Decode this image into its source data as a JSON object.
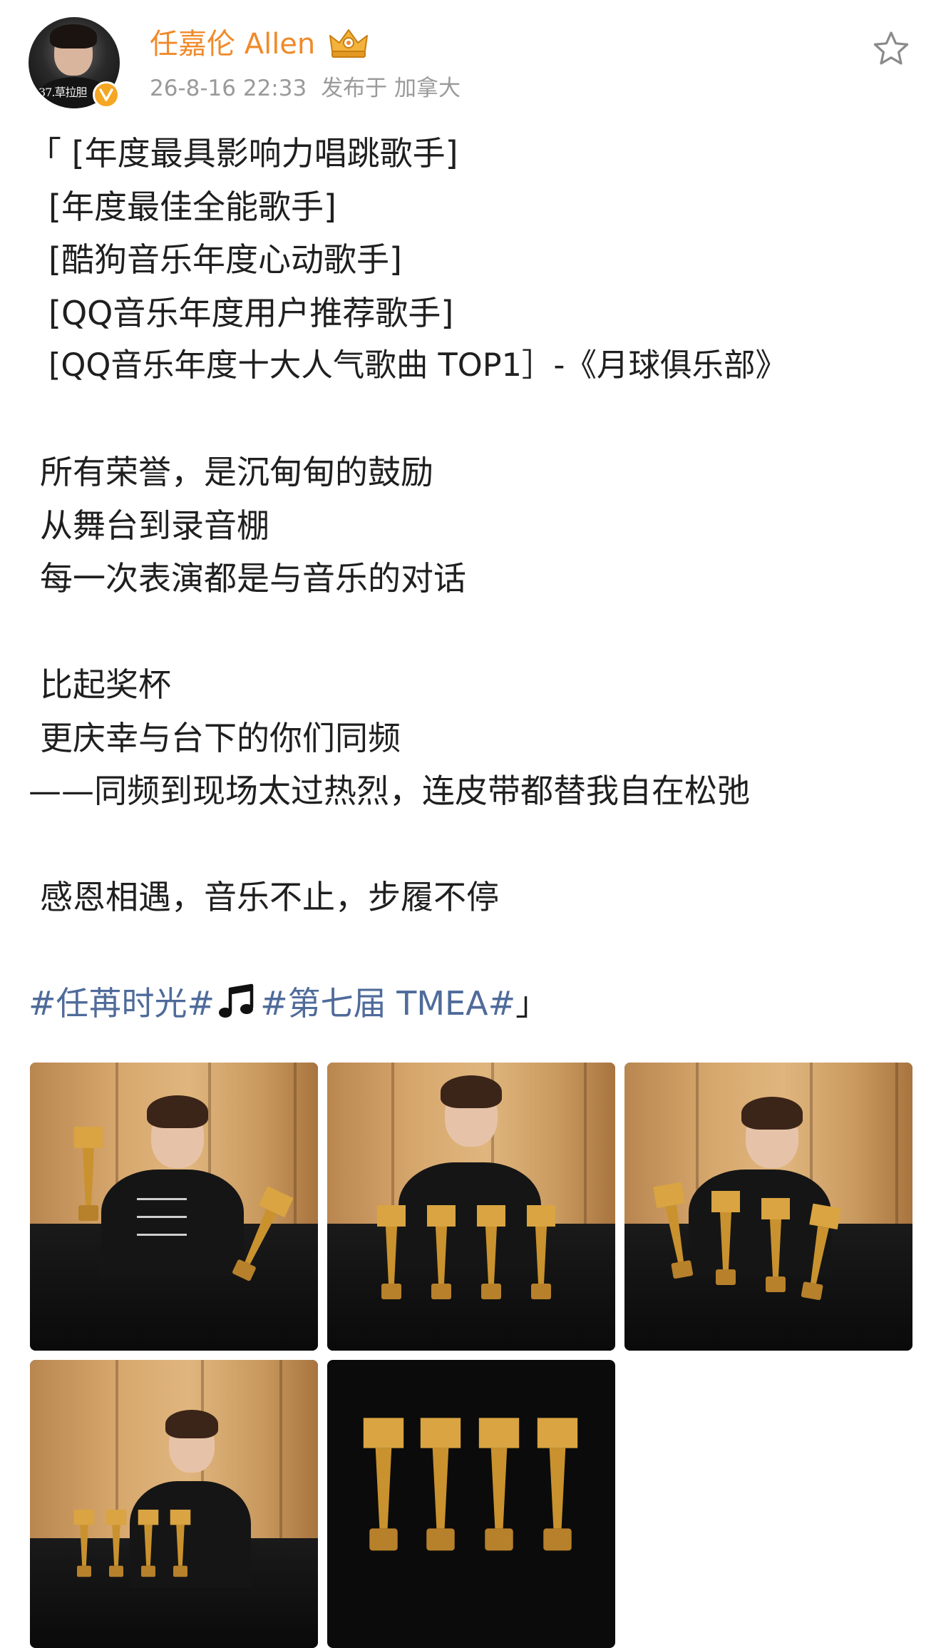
{
  "header": {
    "username": "任嘉伦 Allen",
    "timestamp": "26-8-16 22:33",
    "published_label": "发布于",
    "location": "加拿大",
    "avatar_caption": "37.草拉胆"
  },
  "post": {
    "lines": [
      "「 [年度最具影响力唱跳歌手]",
      "[年度最佳全能歌手]",
      "[酷狗音乐年度心动歌手]",
      "[QQ音乐年度用户推荐歌手]",
      "[QQ音乐年度十大人气歌曲 TOP1］-《月球俱乐部》",
      "",
      "所有荣誉，是沉甸甸的鼓励",
      "从舞台到录音棚",
      "每一次表演都是与音乐的对话",
      "",
      "比起奖杯",
      "更庆幸与台下的你们同频",
      "——同频到现场太过热烈，连皮带都替我自在松弛",
      "",
      "感恩相遇，音乐不止，步履不停",
      ""
    ],
    "hashtag_1": "#任苒时光#",
    "hashtag_2": "#第七届 TMEA#",
    "closing_quote": "」"
  },
  "images": {
    "count": 5,
    "items": [
      {
        "subject": "photo-trophies-holding"
      },
      {
        "subject": "photo-trophies-table-arms-open"
      },
      {
        "subject": "photo-trophies-leaning"
      },
      {
        "subject": "photo-trophies-wide"
      },
      {
        "subject": "photo-four-trophies"
      }
    ]
  },
  "colors": {
    "username": "#f08a2a",
    "meta": "#9a9a9a",
    "hashtag": "#4f6b9a",
    "verified": "#f5a623",
    "trophy_gold": "#d9a441"
  },
  "icons": {
    "favorite": "star-outline-icon",
    "membership": "crown-icon",
    "verified": "verified-v-icon",
    "music": "music-note-icon"
  }
}
